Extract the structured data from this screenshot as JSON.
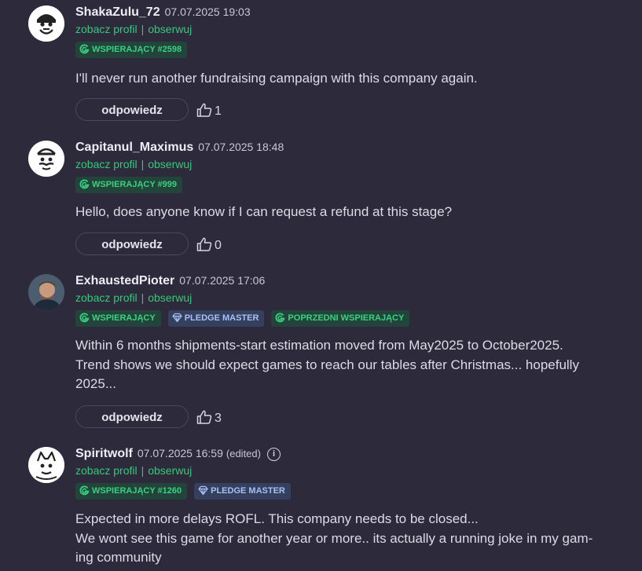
{
  "comments": [
    {
      "username": "ShakaZulu_72",
      "time": "07.07.2025 19:03",
      "profile_link": "zobacz profil",
      "separator": "|",
      "follow_link": "obserwuj",
      "badges": [
        {
          "label": "WSPIERAJĄCY #2598",
          "type": "green",
          "icon": "supporter-icon"
        }
      ],
      "text": "I'll never run another fundraising campaign with this company again.",
      "reply_label": "odpowiedz",
      "likes": "1"
    },
    {
      "username": "Capitanul_Maximus",
      "time": "07.07.2025 18:48",
      "profile_link": "zobacz profil",
      "separator": "|",
      "follow_link": "obserwuj",
      "badges": [
        {
          "label": "WSPIERAJĄCY #999",
          "type": "green",
          "icon": "supporter-icon"
        }
      ],
      "text": "Hello, does anyone know if I can request a refund at this stage?",
      "reply_label": "odpowiedz",
      "likes": "0"
    },
    {
      "username": "ExhaustedPioter",
      "time": "07.07.2025 17:06",
      "profile_link": "zobacz profil",
      "separator": "|",
      "follow_link": "obserwuj",
      "badges": [
        {
          "label": "WSPIERAJĄCY",
          "type": "green",
          "icon": "supporter-icon"
        },
        {
          "label": "PLEDGE MASTER",
          "type": "blue",
          "icon": "diamond-icon"
        },
        {
          "label": "POPRZEDNI WSPIERAJĄCY",
          "type": "green",
          "icon": "supporter-icon"
        }
      ],
      "text_lines": [
        "Within 6 months shipments-start estimation moved from May2025 to October2025.",
        "Trend shows we should expect games to reach our tables after Christmas... hopefully",
        "2025..."
      ],
      "reply_label": "odpowiedz",
      "likes": "3"
    },
    {
      "username": "Spiritwolf",
      "time": "07.07.2025 16:59",
      "edited": "(edited)",
      "info_icon": "i",
      "profile_link": "zobacz profil",
      "separator": "|",
      "follow_link": "obserwuj",
      "badges": [
        {
          "label": "WSPIERAJĄCY #1260",
          "type": "green",
          "icon": "supporter-icon"
        },
        {
          "label": "PLEDGE MASTER",
          "type": "blue",
          "icon": "diamond-icon"
        }
      ],
      "text_lines": [
        "Expected in more delays ROFL. This company needs to be closed...",
        "We wont see this game for another year or more.. its actually a running joke in my gam-",
        "ing community"
      ]
    }
  ],
  "colors": {
    "background": "#2d2a3b",
    "accent_green": "#35c97a",
    "badge_green_bg": "#23443a",
    "badge_blue_bg": "#35405e"
  }
}
